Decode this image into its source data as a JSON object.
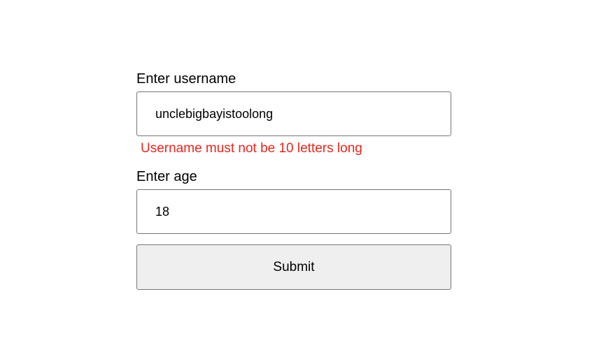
{
  "form": {
    "username": {
      "label": "Enter username",
      "value": "unclebigbayistoolong",
      "error": "Username must not be 10 letters long"
    },
    "age": {
      "label": "Enter age",
      "value": "18"
    },
    "submit_label": "Submit",
    "error_color": "#e8261c"
  }
}
